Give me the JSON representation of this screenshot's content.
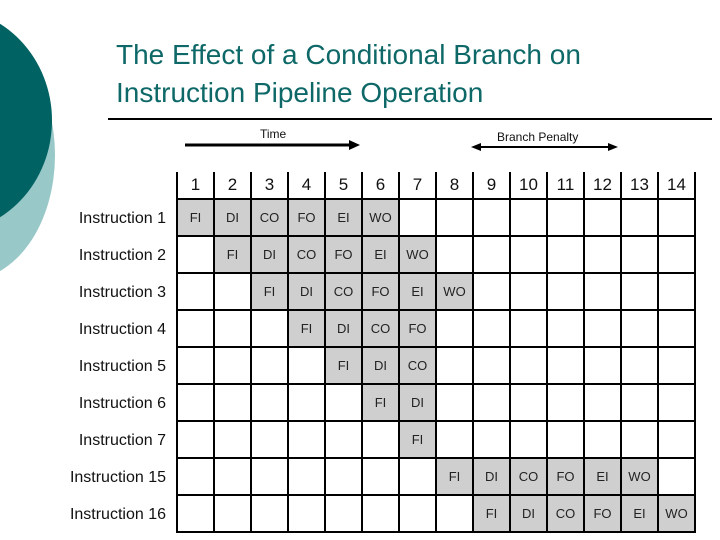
{
  "slide": {
    "title_lines": [
      "The Effect of a Conditional Branch on",
      "Instruction Pipeline Operation"
    ],
    "accent_color": "#0e6868",
    "deco_dark_color": "#006262",
    "deco_light_color": "#98c8c8"
  },
  "diagram": {
    "time_label": "Time",
    "branch_penalty_label": "Branch Penalty",
    "columns": [
      "1",
      "2",
      "3",
      "4",
      "5",
      "6",
      "7",
      "8",
      "9",
      "10",
      "11",
      "12",
      "13",
      "14"
    ],
    "stage_fill_color": "#cfcfcf",
    "rows": [
      {
        "label": "Instruction 1",
        "cells": [
          "FI",
          "DI",
          "CO",
          "FO",
          "EI",
          "WO",
          "",
          "",
          "",
          "",
          "",
          "",
          "",
          ""
        ]
      },
      {
        "label": "Instruction 2",
        "cells": [
          "",
          "FI",
          "DI",
          "CO",
          "FO",
          "EI",
          "WO",
          "",
          "",
          "",
          "",
          "",
          "",
          ""
        ]
      },
      {
        "label": "Instruction 3",
        "cells": [
          "",
          "",
          "FI",
          "DI",
          "CO",
          "FO",
          "EI",
          "WO",
          "",
          "",
          "",
          "",
          "",
          ""
        ]
      },
      {
        "label": "Instruction 4",
        "cells": [
          "",
          "",
          "",
          "FI",
          "DI",
          "CO",
          "FO",
          "",
          "",
          "",
          "",
          "",
          "",
          ""
        ]
      },
      {
        "label": "Instruction 5",
        "cells": [
          "",
          "",
          "",
          "",
          "FI",
          "DI",
          "CO",
          "",
          "",
          "",
          "",
          "",
          "",
          ""
        ]
      },
      {
        "label": "Instruction 6",
        "cells": [
          "",
          "",
          "",
          "",
          "",
          "FI",
          "DI",
          "",
          "",
          "",
          "",
          "",
          "",
          ""
        ]
      },
      {
        "label": "Instruction 7",
        "cells": [
          "",
          "",
          "",
          "",
          "",
          "",
          "FI",
          "",
          "",
          "",
          "",
          "",
          "",
          ""
        ]
      },
      {
        "label": "Instruction 15",
        "cells": [
          "",
          "",
          "",
          "",
          "",
          "",
          "",
          "FI",
          "DI",
          "CO",
          "FO",
          "EI",
          "WO",
          ""
        ]
      },
      {
        "label": "Instruction 16",
        "cells": [
          "",
          "",
          "",
          "",
          "",
          "",
          "",
          "",
          "FI",
          "DI",
          "CO",
          "FO",
          "EI",
          "WO"
        ]
      }
    ]
  }
}
